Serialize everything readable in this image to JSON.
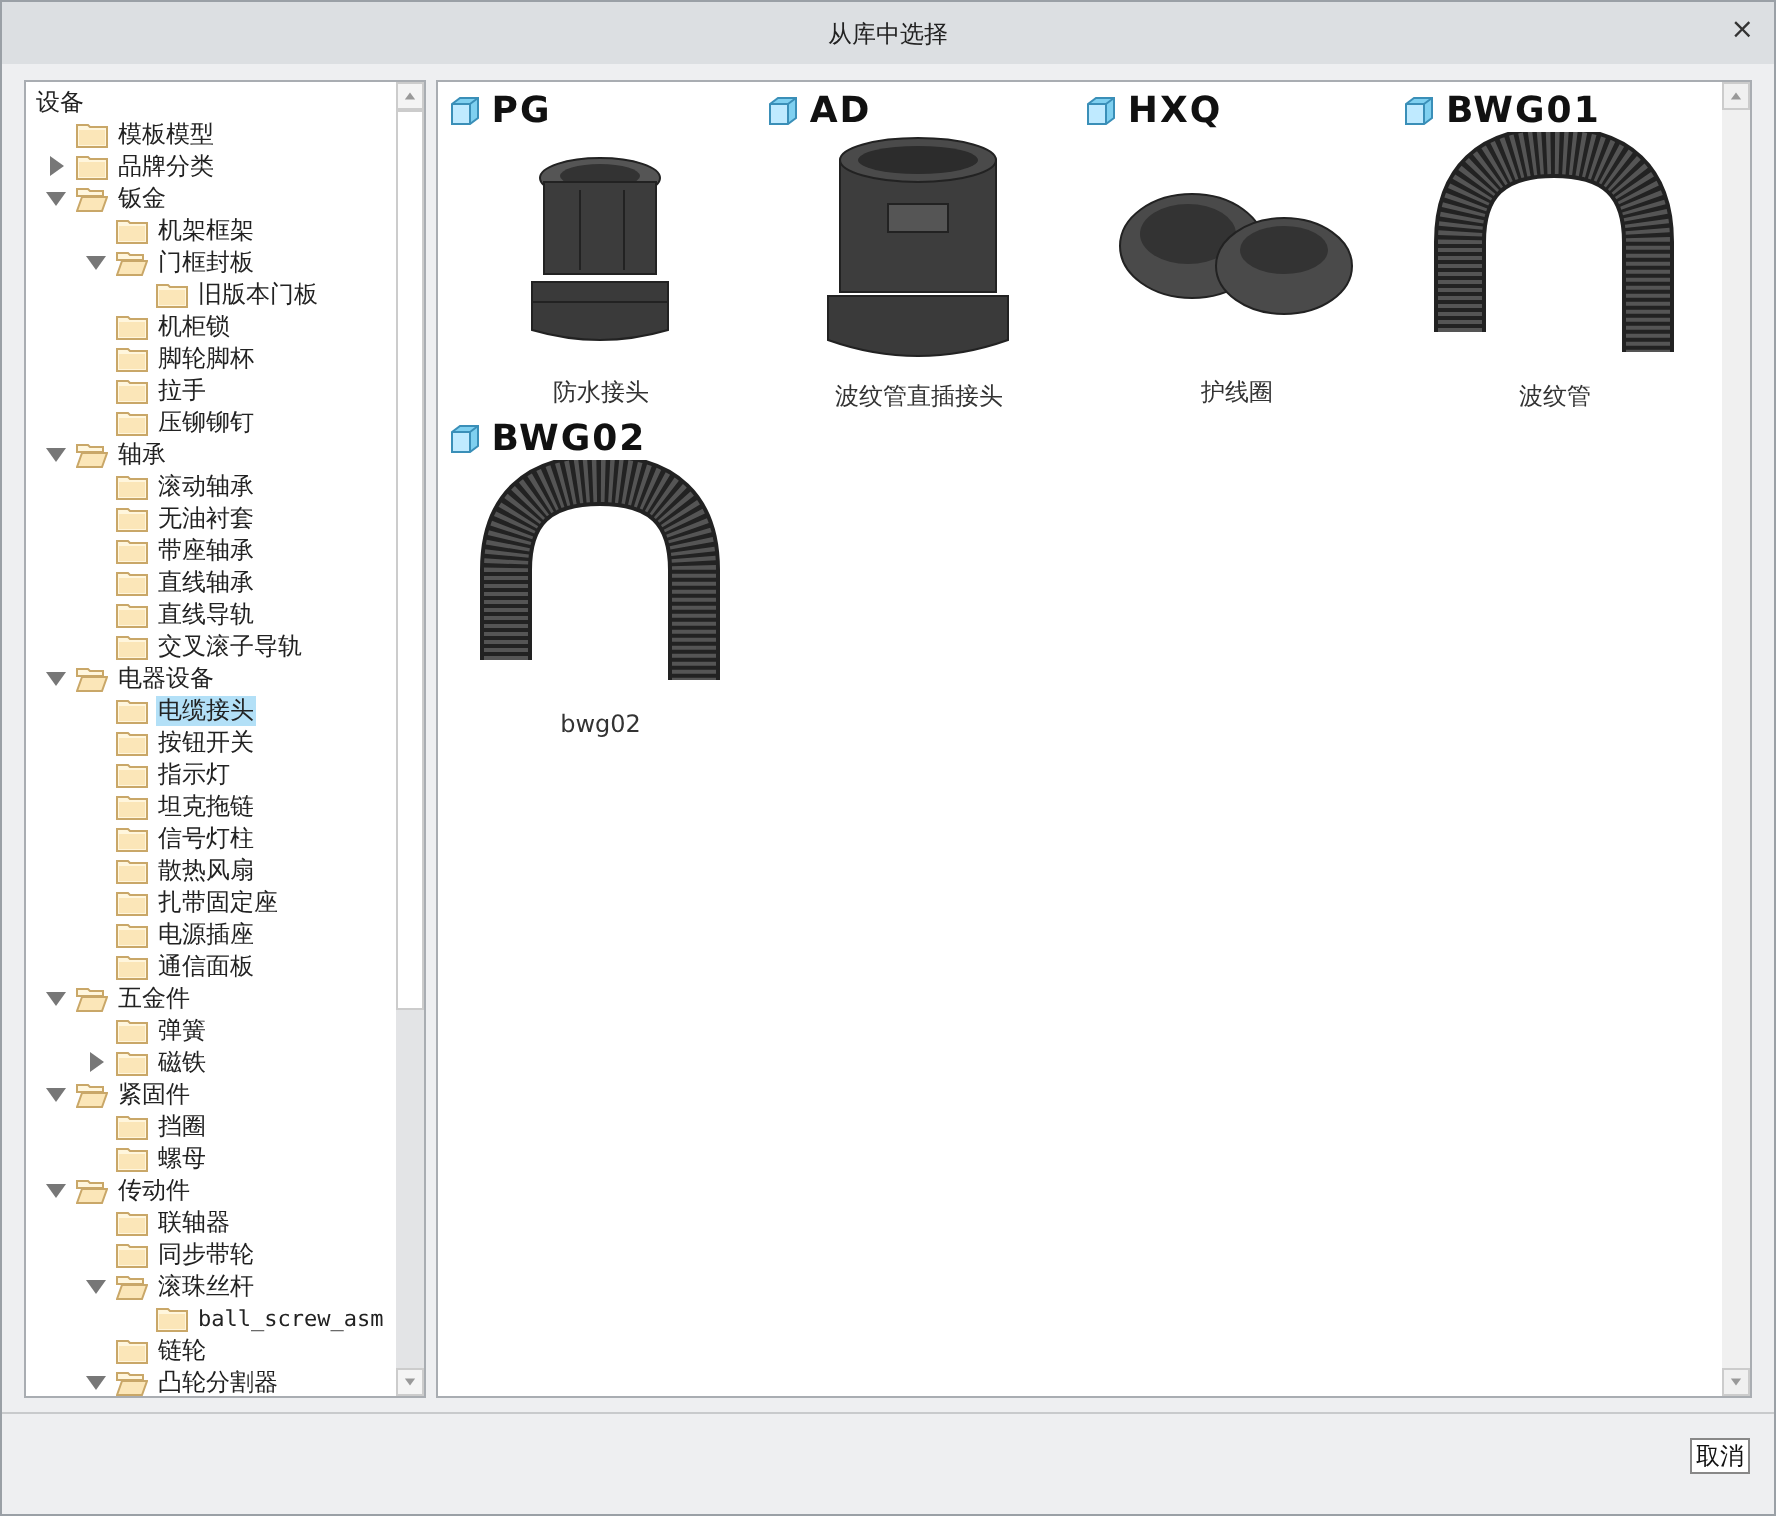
{
  "window": {
    "title": "从库中选择",
    "close": "×"
  },
  "tree": {
    "label": "设备",
    "children": [
      {
        "label": "模板模型",
        "selected": false
      },
      {
        "label": "品牌分类",
        "expanded": false,
        "selected": false
      },
      {
        "label": "钣金",
        "expanded": true,
        "selected": false,
        "children": [
          {
            "label": "机架框架",
            "selected": false
          },
          {
            "label": "门框封板",
            "expanded": true,
            "selected": false,
            "children": [
              {
                "label": "旧版本门板",
                "selected": false
              }
            ]
          },
          {
            "label": "机柜锁",
            "selected": false
          },
          {
            "label": "脚轮脚杯",
            "selected": false
          },
          {
            "label": "拉手",
            "selected": false
          },
          {
            "label": "压铆铆钉",
            "selected": false
          }
        ]
      },
      {
        "label": "轴承",
        "expanded": true,
        "selected": false,
        "children": [
          {
            "label": "滚动轴承",
            "selected": false
          },
          {
            "label": "无油衬套",
            "selected": false
          },
          {
            "label": "带座轴承",
            "selected": false
          },
          {
            "label": "直线轴承",
            "selected": false
          },
          {
            "label": "直线导轨",
            "selected": false
          },
          {
            "label": "交叉滚子导轨",
            "selected": false
          }
        ]
      },
      {
        "label": "电器设备",
        "expanded": true,
        "selected": false,
        "children": [
          {
            "label": "电缆接头",
            "selected": true
          },
          {
            "label": "按钮开关",
            "selected": false
          },
          {
            "label": "指示灯",
            "selected": false
          },
          {
            "label": "坦克拖链",
            "selected": false
          },
          {
            "label": "信号灯柱",
            "selected": false
          },
          {
            "label": "散热风扇",
            "selected": false
          },
          {
            "label": "扎带固定座",
            "selected": false
          },
          {
            "label": "电源插座",
            "selected": false
          },
          {
            "label": "通信面板",
            "selected": false
          }
        ]
      },
      {
        "label": "五金件",
        "expanded": true,
        "selected": false,
        "children": [
          {
            "label": "弹簧",
            "selected": false
          },
          {
            "label": "磁铁",
            "expanded": false,
            "selected": false
          }
        ]
      },
      {
        "label": "紧固件",
        "expanded": true,
        "selected": false,
        "children": [
          {
            "label": "挡圈",
            "selected": false
          },
          {
            "label": "螺母",
            "selected": false
          }
        ]
      },
      {
        "label": "传动件",
        "expanded": true,
        "selected": false,
        "children": [
          {
            "label": "联轴器",
            "selected": false
          },
          {
            "label": "同步带轮",
            "selected": false
          },
          {
            "label": "滚珠丝杆",
            "expanded": true,
            "selected": false,
            "children": [
              {
                "label": "ball_screw_asm",
                "selected": false
              }
            ]
          },
          {
            "label": "链轮",
            "selected": false
          },
          {
            "label": "凸轮分割器",
            "expanded": true,
            "selected": false
          }
        ]
      }
    ]
  },
  "items": [
    {
      "name": "PG",
      "caption": "防水接头",
      "kind": "gland"
    },
    {
      "name": "AD",
      "caption": "波纹管直插接头",
      "kind": "connector"
    },
    {
      "name": "HXQ",
      "caption": "护线圈",
      "kind": "grommet"
    },
    {
      "name": "BWG01",
      "caption": "波纹管",
      "kind": "tube"
    },
    {
      "name": "BWG02",
      "caption": "bwg02",
      "kind": "tube"
    }
  ],
  "buttons": [
    {
      "label": "取消"
    }
  ]
}
